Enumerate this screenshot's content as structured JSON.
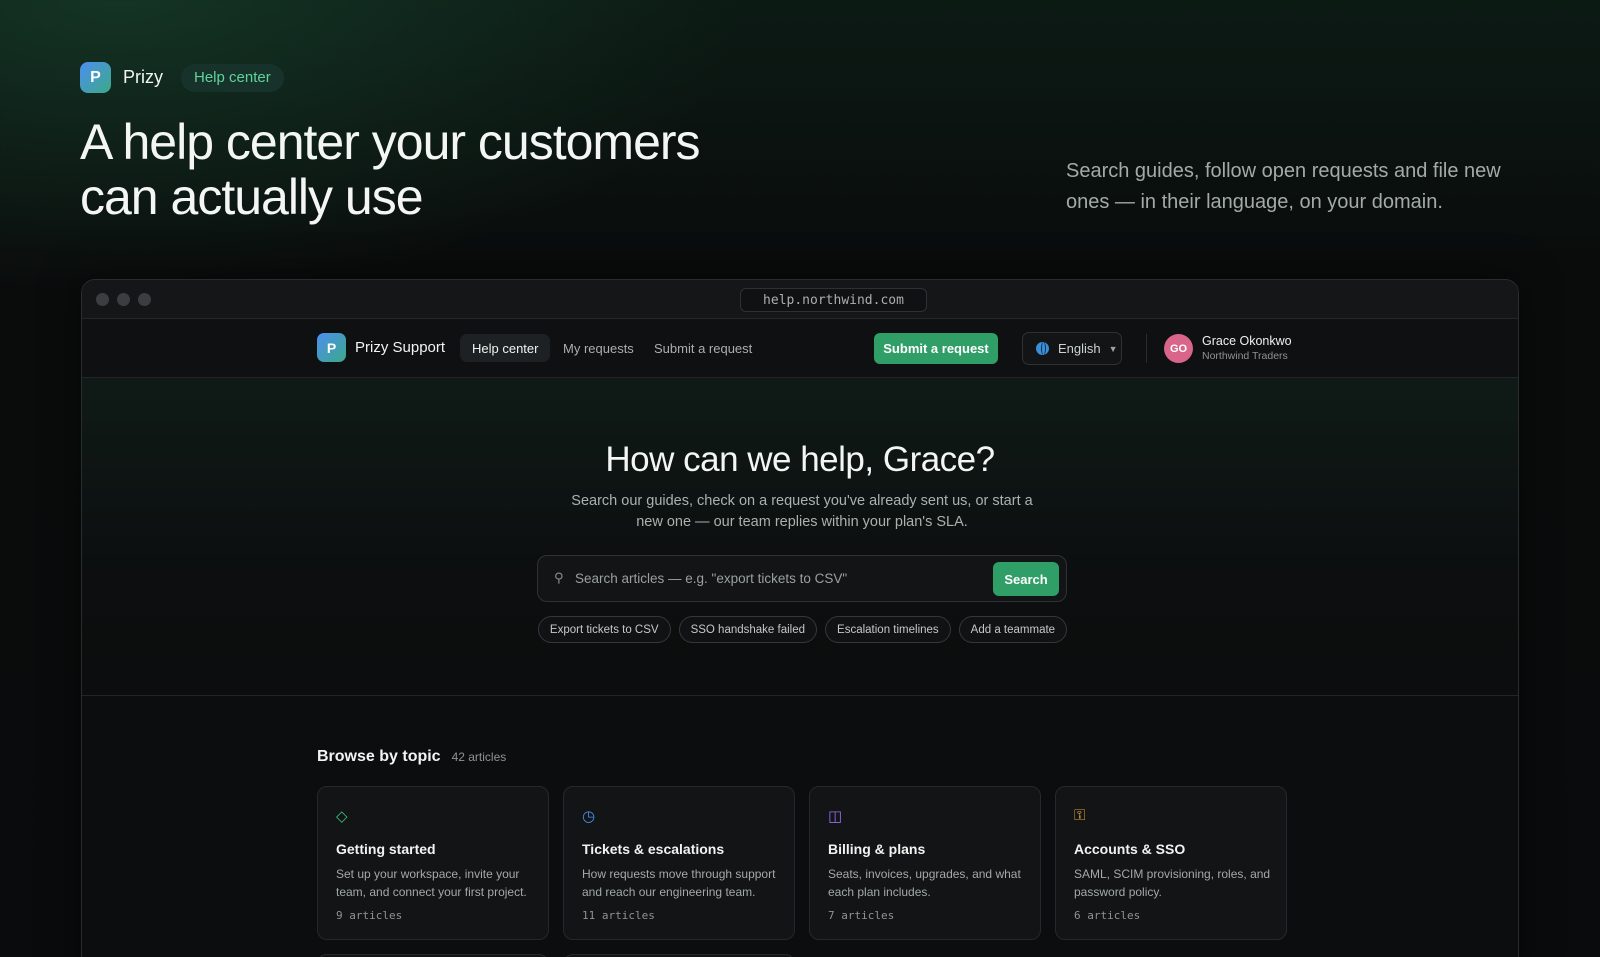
{
  "brand": {
    "logo_letter": "P",
    "name": "Prizy",
    "badge": "Help center"
  },
  "hero": {
    "title": "A help center your customers can actually use",
    "subtitle": "Search guides, follow open requests and file new ones — in their language, on your domain."
  },
  "browser": {
    "url": "help.northwind.com"
  },
  "appnav": {
    "logo_letter": "P",
    "app_name": "Prizy Support",
    "links": [
      {
        "label": "Help center",
        "active": true
      },
      {
        "label": "My requests",
        "active": false
      },
      {
        "label": "Submit a request",
        "active": false
      }
    ],
    "cta_label": "Submit a request",
    "language": "English",
    "user": {
      "initials": "GO",
      "name": "Grace Okonkwo",
      "org": "Northwind Traders"
    }
  },
  "help_hero": {
    "title": "How can we help, Grace?",
    "subtitle": "Search our guides, check on a request you've already sent us, or start a new one — our team replies within your plan's SLA.",
    "search_placeholder": "Search articles — e.g. \"export tickets to CSV\"",
    "search_button": "Search",
    "chips": [
      "Export tickets to CSV",
      "SSO handshake failed",
      "Escalation timelines",
      "Add a teammate"
    ]
  },
  "topics": {
    "title": "Browse by topic",
    "count": "42 articles",
    "cards": [
      {
        "icon": "diamond-icon",
        "glyph": "◇",
        "color": "#3fc07c",
        "title": "Getting started",
        "desc": "Set up your workspace, invite your team, and connect your first project.",
        "count": "9 articles"
      },
      {
        "icon": "clock-icon",
        "glyph": "◷",
        "color": "#4a8ff0",
        "title": "Tickets & escalations",
        "desc": "How requests move through support and reach our engineering team.",
        "count": "11 articles"
      },
      {
        "icon": "book-icon",
        "glyph": "◫",
        "color": "#9b6ef0",
        "title": "Billing & plans",
        "desc": "Seats, invoices, upgrades, and what each plan includes.",
        "count": "7 articles"
      },
      {
        "icon": "key-icon",
        "glyph": "⚿",
        "color": "#e0a03a",
        "title": "Accounts & SSO",
        "desc": "SAML, SCIM provisioning, roles, and password policy.",
        "count": "6 articles"
      }
    ]
  }
}
